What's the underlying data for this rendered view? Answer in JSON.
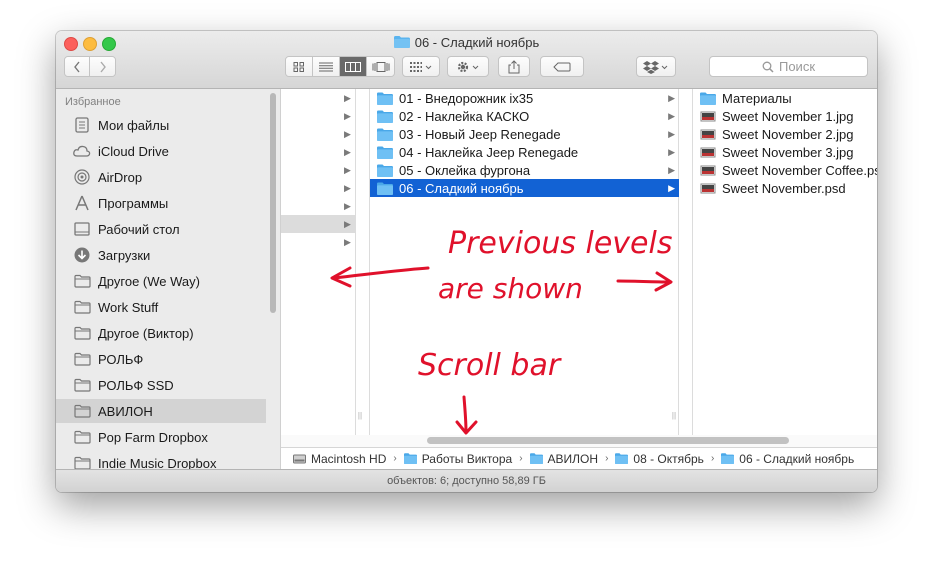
{
  "window": {
    "title": "06 - Сладкий ноябрь",
    "search_placeholder": "Поиск"
  },
  "sidebar": {
    "header": "Избранное",
    "items": [
      {
        "label": "Мои файлы",
        "icon": "all-files-icon"
      },
      {
        "label": "iCloud Drive",
        "icon": "cloud-icon"
      },
      {
        "label": "AirDrop",
        "icon": "airdrop-icon"
      },
      {
        "label": "Программы",
        "icon": "applications-icon"
      },
      {
        "label": "Рабочий стол",
        "icon": "desktop-icon"
      },
      {
        "label": "Загрузки",
        "icon": "download-icon"
      },
      {
        "label": "Другое (We Way)",
        "icon": "folder-icon"
      },
      {
        "label": "Work Stuff",
        "icon": "folder-icon"
      },
      {
        "label": "Другое (Виктор)",
        "icon": "folder-icon"
      },
      {
        "label": "РОЛЬФ",
        "icon": "folder-icon"
      },
      {
        "label": "РОЛЬФ SSD",
        "icon": "folder-icon"
      },
      {
        "label": "АВИЛОН",
        "icon": "folder-icon",
        "selected": true
      },
      {
        "label": "Pop Farm Dropbox",
        "icon": "folder-icon"
      },
      {
        "label": "Indie Music Dropbox",
        "icon": "folder-icon"
      }
    ]
  },
  "columns": {
    "middle": [
      {
        "label": "01 - Внедорожник ix35"
      },
      {
        "label": "02 - Наклейка КАСКО"
      },
      {
        "label": "03 - Новый Jeep Renegade"
      },
      {
        "label": "04 - Наклейка Jeep Renegade"
      },
      {
        "label": "05 - Оклейка фургона"
      },
      {
        "label": "06 - Сладкий ноябрь",
        "selected": true
      }
    ],
    "right": [
      {
        "label": "Материалы",
        "type": "folder"
      },
      {
        "label": "Sweet November 1.jpg",
        "type": "file"
      },
      {
        "label": "Sweet November 2.jpg",
        "type": "file"
      },
      {
        "label": "Sweet November 3.jpg",
        "type": "file"
      },
      {
        "label": "Sweet November Coffee.psd",
        "type": "file"
      },
      {
        "label": "Sweet November.psd",
        "type": "file"
      }
    ]
  },
  "path_bar": [
    {
      "label": "Macintosh HD",
      "icon": "hard-drive-icon"
    },
    {
      "label": "Работы Виктора",
      "icon": "folder-icon"
    },
    {
      "label": "АВИЛОН",
      "icon": "folder-icon"
    },
    {
      "label": "08 - Октябрь",
      "icon": "folder-icon"
    },
    {
      "label": "06 - Сладкий ноябрь",
      "icon": "folder-icon"
    }
  ],
  "status": "объектов: 6; доступно 58,89 ГБ",
  "annotations": {
    "line1": "Previous levels",
    "line2": "are shown",
    "line3": "Scroll bar"
  },
  "colors": {
    "selection": "#1262d4",
    "folder": "#5ab4ef",
    "annotation": "#e0112b"
  }
}
